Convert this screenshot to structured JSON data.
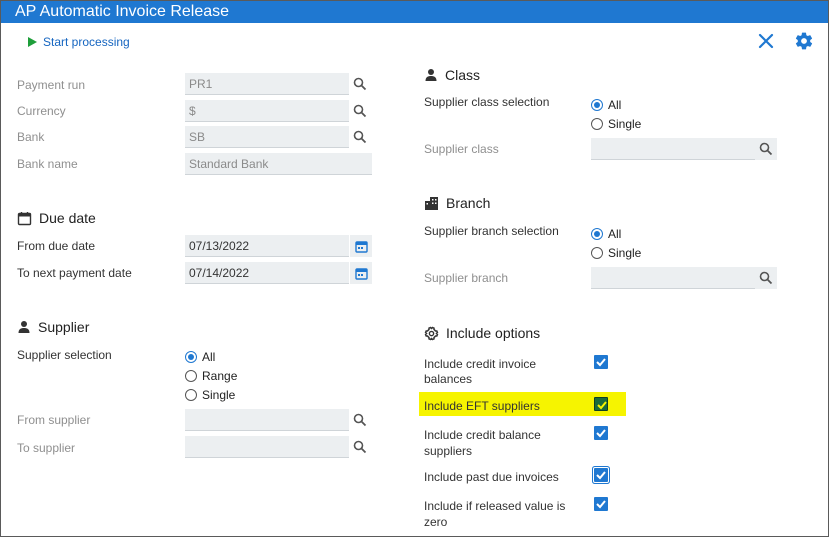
{
  "window": {
    "title": "AP Automatic Invoice Release"
  },
  "toolbar": {
    "start_label": "Start processing"
  },
  "payment": {
    "run_label": "Payment run",
    "run_value": "PR1",
    "currency_label": "Currency",
    "currency_value": "$",
    "bank_label": "Bank",
    "bank_value": "SB",
    "bank_name_label": "Bank name",
    "bank_name_value": "Standard Bank"
  },
  "due_date": {
    "title": "Due date",
    "from_label": "From due date",
    "from_value": "07/13/2022",
    "to_label": "To next payment date",
    "to_value": "07/14/2022"
  },
  "supplier": {
    "title": "Supplier",
    "selection_label": "Supplier selection",
    "options": [
      "All",
      "Range",
      "Single"
    ],
    "selected": "All",
    "from_label": "From supplier",
    "to_label": "To supplier"
  },
  "class": {
    "title": "Class",
    "selection_label": "Supplier class selection",
    "options": [
      "All",
      "Single"
    ],
    "selected": "All",
    "field_label": "Supplier class"
  },
  "branch": {
    "title": "Branch",
    "selection_label": "Supplier branch selection",
    "options": [
      "All",
      "Single"
    ],
    "selected": "All",
    "field_label": "Supplier branch"
  },
  "include": {
    "title": "Include options",
    "credit_invoice_line1": "Include credit invoice",
    "credit_invoice_line2": "balances",
    "eft": "Include EFT suppliers",
    "credit_balance_line1": "Include credit balance",
    "credit_balance_line2": "suppliers",
    "past_due": "Include past due invoices",
    "released_zero_line1": "Include if released value is",
    "released_zero_line2": "zero",
    "checked": [
      true,
      true,
      true,
      true,
      true
    ]
  },
  "colors": {
    "accent": "#1f78d1",
    "highlight": "#f6f400",
    "play": "#1e9e3a"
  }
}
